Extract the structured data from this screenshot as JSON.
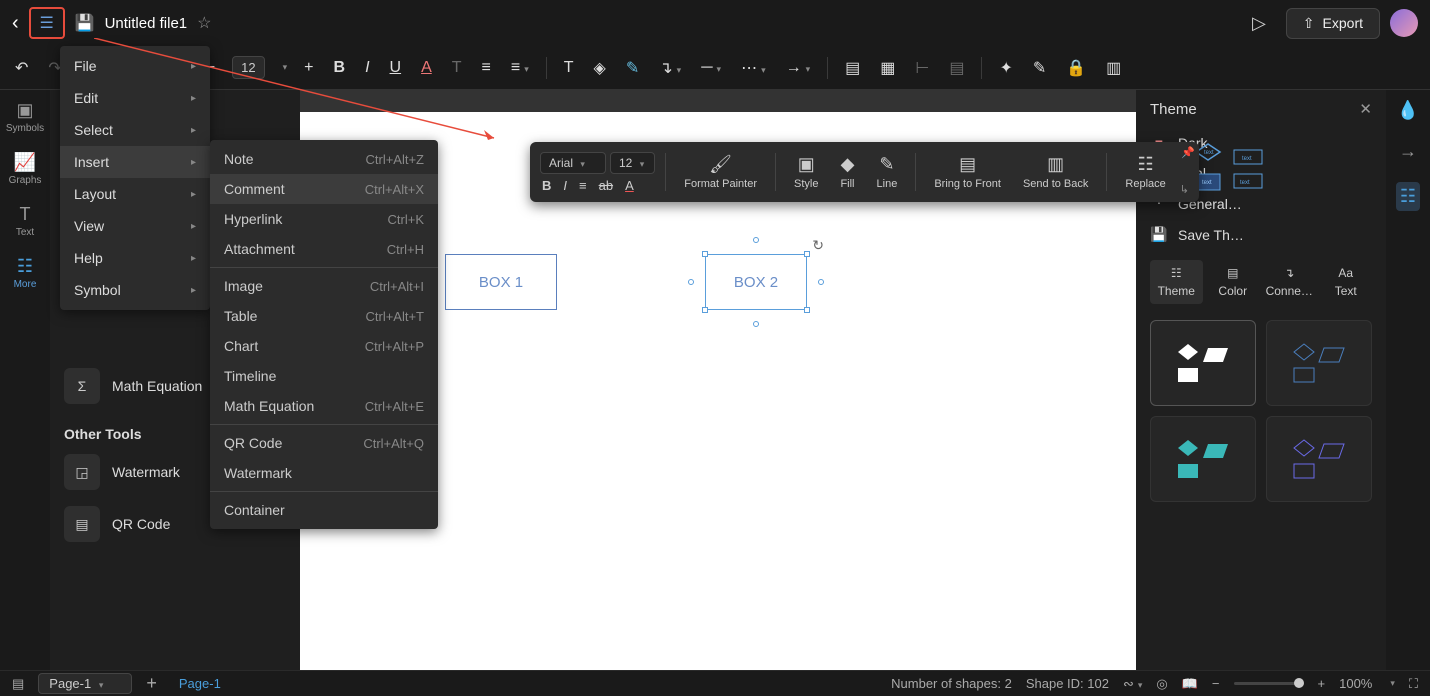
{
  "topbar": {
    "file_title": "Untitled file1",
    "export_label": "Export"
  },
  "toolbar": {
    "font_size": "12"
  },
  "left_rail": {
    "items": [
      "Symbols",
      "Graphs",
      "Text",
      "More"
    ]
  },
  "left_panel": {
    "math_eq": "Math Equation",
    "other_tools_head": "Other Tools",
    "watermark": "Watermark",
    "qr_code": "QR Code"
  },
  "main_menu": {
    "items": [
      "File",
      "Edit",
      "Select",
      "Insert",
      "Layout",
      "View",
      "Help",
      "Symbol"
    ],
    "highlighted": "Insert"
  },
  "insert_submenu": [
    {
      "label": "Note",
      "sc": "Ctrl+Alt+Z"
    },
    {
      "label": "Comment",
      "sc": "Ctrl+Alt+X",
      "hl": true
    },
    {
      "label": "Hyperlink",
      "sc": "Ctrl+K"
    },
    {
      "label": "Attachment",
      "sc": "Ctrl+H"
    },
    {
      "sep": true
    },
    {
      "label": "Image",
      "sc": "Ctrl+Alt+I"
    },
    {
      "label": "Table",
      "sc": "Ctrl+Alt+T"
    },
    {
      "label": "Chart",
      "sc": "Ctrl+Alt+P"
    },
    {
      "label": "Timeline",
      "sc": ""
    },
    {
      "label": "Math Equation",
      "sc": "Ctrl+Alt+E"
    },
    {
      "sep": true
    },
    {
      "label": "QR Code",
      "sc": "Ctrl+Alt+Q"
    },
    {
      "label": "Watermark",
      "sc": ""
    },
    {
      "sep": true
    },
    {
      "label": "Container",
      "sc": ""
    }
  ],
  "canvas": {
    "box1": "BOX 1",
    "box2": "BOX 2"
  },
  "ctx_toolbar": {
    "font": "Arial",
    "size": "12",
    "format_painter": "Format Painter",
    "style": "Style",
    "fill": "Fill",
    "line": "Line",
    "bring_front": "Bring to Front",
    "send_back": "Send to Back",
    "replace": "Replace"
  },
  "right_panel": {
    "title": "Theme",
    "dark": "Dark",
    "arial": "Arial",
    "general": "General…",
    "save_theme": "Save Th…",
    "tabs": [
      "Theme",
      "Color",
      "Conne…",
      "Text"
    ]
  },
  "bottom_bar": {
    "page_select": "Page-1",
    "page_tab": "Page-1",
    "shape_count": "Number of shapes: 2",
    "shape_id": "Shape ID: 102",
    "zoom": "100%"
  }
}
